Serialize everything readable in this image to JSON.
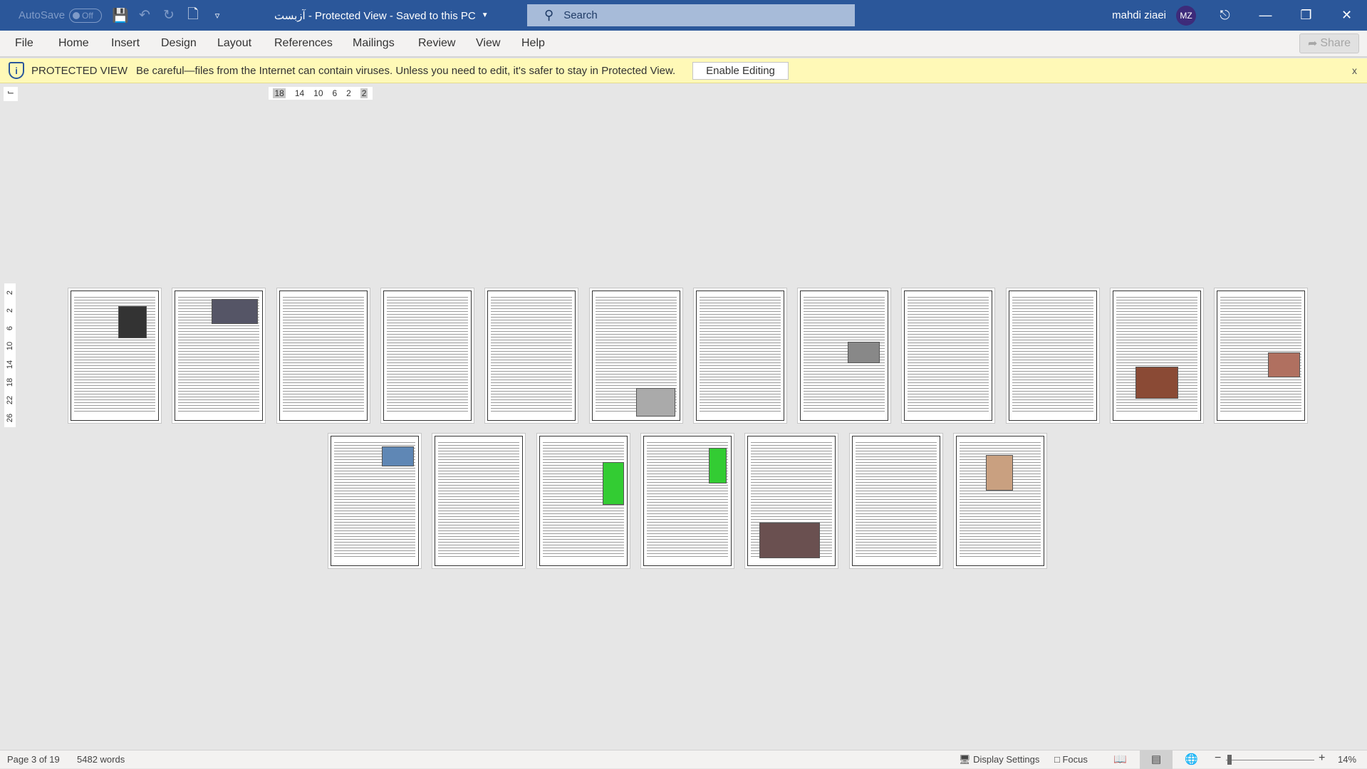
{
  "titlebar": {
    "autosave": "AutoSave",
    "autosave_state": "Off",
    "doc_title": "آزبست  -  Protected View  -  Saved to this PC",
    "search_placeholder": "Search",
    "user_name": "mahdi ziaei",
    "user_initials": "MZ"
  },
  "ribbon": {
    "tabs": [
      "File",
      "Home",
      "Insert",
      "Design",
      "Layout",
      "References",
      "Mailings",
      "Review",
      "View",
      "Help"
    ],
    "share": "Share"
  },
  "protected_view": {
    "heading": "PROTECTED VIEW",
    "message": "Be careful—files from the Internet can contain viruses. Unless you need to edit, it's safer to stay in Protected View.",
    "button": "Enable Editing",
    "close": "x"
  },
  "ruler": {
    "horizontal": [
      "18",
      "14",
      "10",
      "6",
      "2",
      "2"
    ],
    "vertical": [
      "2",
      "2",
      "6",
      "10",
      "14",
      "18",
      "22",
      "26"
    ]
  },
  "status": {
    "page": "Page 3 of 19",
    "words": "5482 words",
    "display_settings": "Display Settings",
    "focus": "Focus",
    "zoom": "14%"
  },
  "colors": {
    "title_bar": "#2b579a",
    "protected_bar": "#fff9b7"
  }
}
